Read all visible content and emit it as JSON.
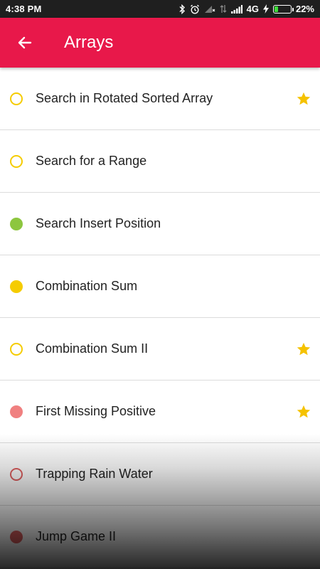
{
  "status_bar": {
    "time": "4:38 PM",
    "network": "4G",
    "battery": "22%",
    "battery_level": 0.22,
    "icons": [
      "bluetooth-icon",
      "alarm-icon",
      "signal-off-icon",
      "data-arrows-icon",
      "signal-bars-icon",
      "charging-bolt-icon",
      "battery-icon"
    ]
  },
  "app_bar": {
    "title": "Arrays",
    "back_icon": "arrow-left-icon",
    "color": "#e8184a"
  },
  "items": [
    {
      "label": "Search in Rotated Sorted Array",
      "status": "outline",
      "color": "#f5cc00",
      "starred": true
    },
    {
      "label": "Search for a Range",
      "status": "outline",
      "color": "#f5cc00",
      "starred": false
    },
    {
      "label": "Search Insert Position",
      "status": "filled",
      "color": "#8dc63f",
      "starred": false
    },
    {
      "label": "Combination Sum",
      "status": "filled",
      "color": "#f5cc00",
      "starred": false
    },
    {
      "label": "Combination Sum II",
      "status": "outline",
      "color": "#f5cc00",
      "starred": true
    },
    {
      "label": "First Missing Positive",
      "status": "filled",
      "color": "#f08080",
      "starred": true
    },
    {
      "label": "Trapping Rain Water",
      "status": "outline",
      "color": "#e06060",
      "starred": false
    },
    {
      "label": "Jump Game II",
      "status": "filled",
      "color": "#e06060",
      "starred": false
    }
  ],
  "star_color": "#f5c200"
}
